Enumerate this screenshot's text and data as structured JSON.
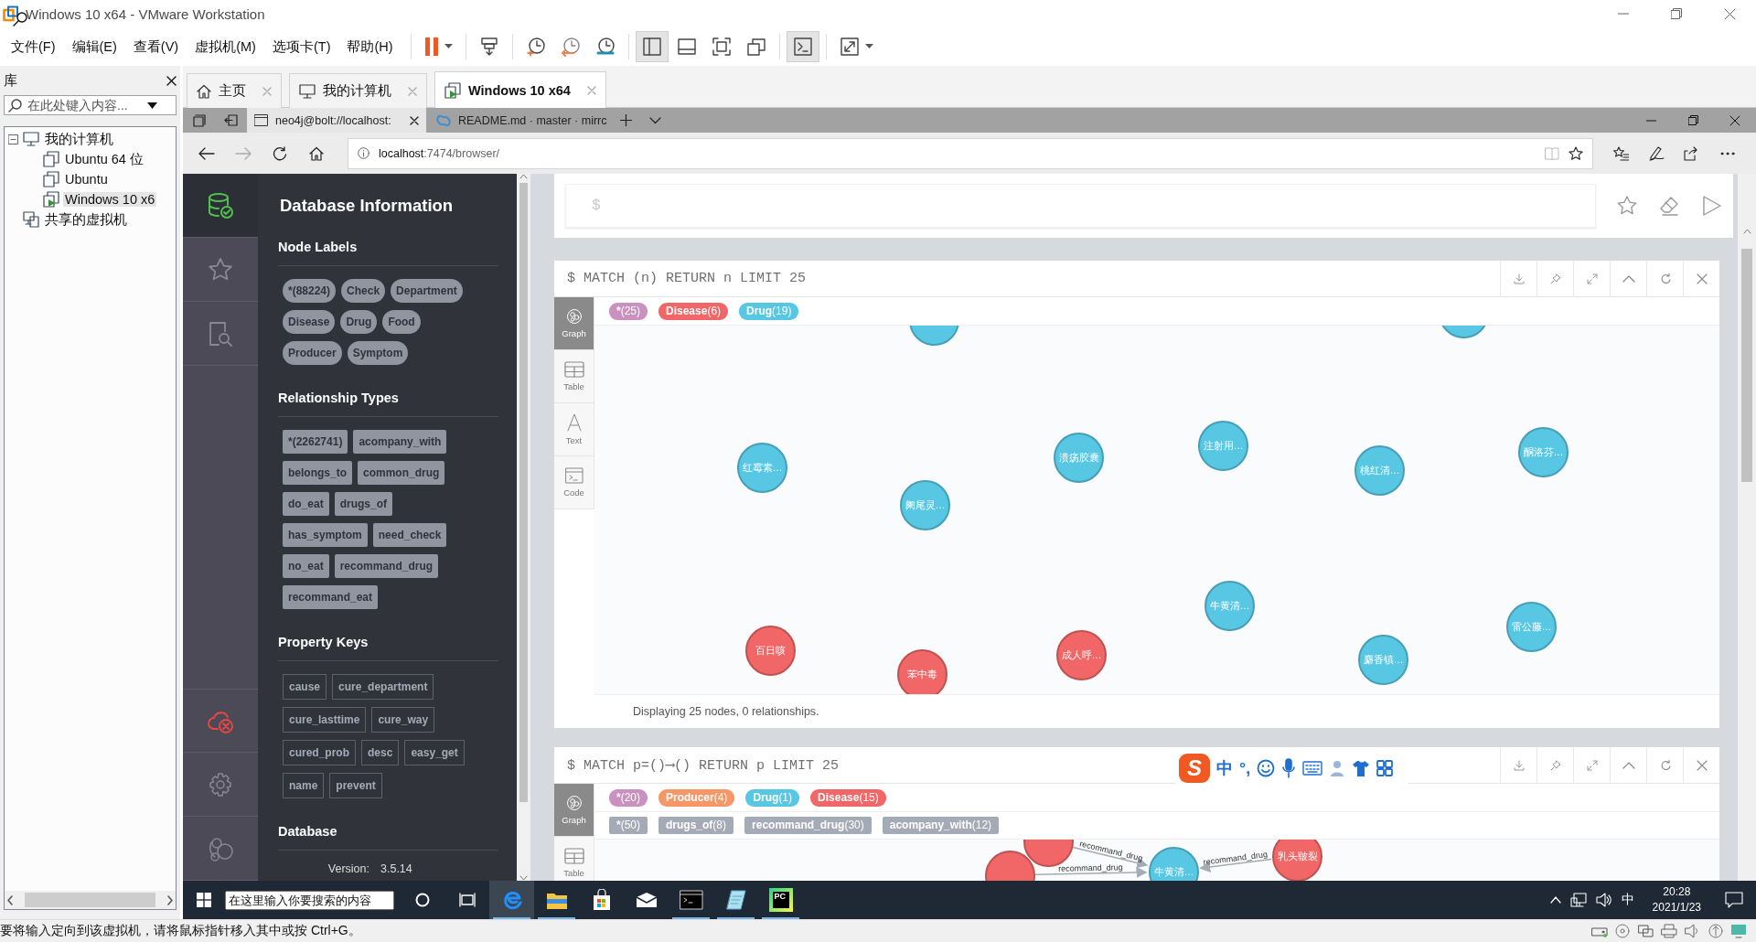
{
  "window": {
    "title": "Windows 10 x64 - VMware Workstation"
  },
  "menu": [
    "文件(F)",
    "编辑(E)",
    "查看(V)",
    "虚拟机(M)",
    "选项卡(T)",
    "帮助(H)"
  ],
  "toolbar": [
    {
      "kind": "pause",
      "on": false
    },
    {
      "kind": "send-keys",
      "on": false
    },
    {
      "kind": "snapshot",
      "on": false
    },
    {
      "kind": "revert",
      "on": false
    },
    {
      "kind": "snapshot-manager",
      "on": false
    },
    {
      "kind": "library",
      "on": true
    },
    {
      "kind": "thumbnails",
      "on": false
    },
    {
      "kind": "fullscreen",
      "on": false
    },
    {
      "kind": "unity",
      "on": false
    },
    {
      "kind": "console",
      "on": true
    },
    {
      "kind": "stretch",
      "on": false
    }
  ],
  "library": {
    "title": "库",
    "search": {
      "placeholder": "在此处键入内容..."
    },
    "tree": [
      {
        "kind": "computer",
        "label": "我的计算机",
        "selected": false,
        "expanded": true,
        "children": [
          {
            "kind": "vm",
            "label": "Ubuntu 64 位",
            "selected": false
          },
          {
            "kind": "vm",
            "label": "Ubuntu",
            "selected": false
          },
          {
            "kind": "running-vm",
            "label": "Windows 10 x6",
            "selected": true
          }
        ]
      },
      {
        "kind": "shared",
        "label": "共享的虚拟机",
        "selected": false
      }
    ]
  },
  "vm_tabs": [
    {
      "kind": "home",
      "label": "主页",
      "selected": false
    },
    {
      "kind": "computer",
      "label": "我的计算机",
      "selected": false
    },
    {
      "kind": "vm",
      "label": "Windows 10 x64",
      "selected": true
    }
  ],
  "browser": {
    "tabs": [
      {
        "kind": "page",
        "label": "neo4j@bolt://localhost:",
        "selected": true
      },
      {
        "kind": "repo",
        "label": "README.md · master · mirrc",
        "selected": false
      }
    ],
    "address": {
      "host": "localhost",
      "path": ":7474/browser/"
    }
  },
  "neo4j": {
    "nav": [
      {
        "kind": "database",
        "selected": true
      },
      {
        "kind": "favorites",
        "selected": false
      },
      {
        "kind": "guides",
        "selected": false
      },
      {
        "kind": "connection",
        "selected": false
      },
      {
        "kind": "settings",
        "selected": false
      },
      {
        "kind": "about",
        "selected": false
      }
    ],
    "sidebar": {
      "title": "Database Information",
      "sections": [
        {
          "kind": "labels",
          "heading": "Node Labels",
          "items": [
            "*(88224)",
            "Check",
            "Department",
            "Disease",
            "Drug",
            "Food",
            "Producer",
            "Symptom"
          ]
        },
        {
          "kind": "relationships",
          "heading": "Relationship Types",
          "items": [
            "*(2262741)",
            "acompany_with",
            "belongs_to",
            "common_drug",
            "do_eat",
            "drugs_of",
            "has_symptom",
            "need_check",
            "no_eat",
            "recommand_drug",
            "recommand_eat"
          ]
        },
        {
          "kind": "properties",
          "heading": "Property Keys",
          "items": [
            "cause",
            "cure_department",
            "cure_lasttime",
            "cure_way",
            "cured_prob",
            "desc",
            "easy_get",
            "name",
            "prevent"
          ]
        },
        {
          "kind": "info",
          "heading": "Database",
          "rows": [
            {
              "key": "Version:",
              "value": "3.5.14"
            }
          ]
        }
      ]
    },
    "editor": {
      "prompt": "$"
    },
    "frames": [
      {
        "query": "$ MATCH (n) RETURN n LIMIT 25",
        "views": [
          {
            "kind": "graph",
            "label": "Graph",
            "selected": true
          },
          {
            "kind": "table",
            "label": "Table",
            "selected": false
          },
          {
            "kind": "text",
            "label": "Text",
            "selected": false
          },
          {
            "kind": "code",
            "label": "Code",
            "selected": false
          }
        ],
        "node_legend": [
          {
            "label": "*",
            "count": "(25)",
            "color": "#c990c0"
          },
          {
            "label": "Disease",
            "count": "(6)",
            "color": "#f16667"
          },
          {
            "label": "Drug",
            "count": "(19)",
            "color": "#57c7e3"
          }
        ],
        "nodes": [
          {
            "color": "#57c7e3"
          },
          {
            "label": "红霉素…",
            "color": "#57c7e3"
          },
          {
            "label": "阑尾灵…",
            "color": "#57c7e3"
          },
          {
            "label": "溃疡胶囊",
            "color": "#57c7e3"
          },
          {
            "label": "注射用…",
            "color": "#57c7e3"
          },
          {
            "label": "桃红清…",
            "color": "#57c7e3"
          },
          {
            "label": "酮洛芬…",
            "color": "#57c7e3"
          },
          {
            "color": "#57c7e3"
          },
          {
            "label": "牛黄清…",
            "color": "#57c7e3"
          },
          {
            "label": "雷公藤…",
            "color": "#57c7e3"
          },
          {
            "label": "麝香镇…",
            "color": "#57c7e3"
          },
          {
            "label": "百日咳",
            "color": "#f16667"
          },
          {
            "label": "苯中毒",
            "color": "#f16667"
          },
          {
            "label": "成人呼…",
            "color": "#f16667"
          }
        ],
        "status": "Displaying 25 nodes, 0 relationships."
      },
      {
        "query": "$ MATCH p=()⟶() RETURN p LIMIT 25",
        "views": [
          {
            "kind": "graph",
            "label": "Graph",
            "selected": true
          },
          {
            "kind": "table",
            "label": "Table",
            "selected": false
          }
        ],
        "node_legend": [
          {
            "label": "*",
            "count": "(20)",
            "color": "#c990c0"
          },
          {
            "label": "Producer",
            "count": "(4)",
            "color": "#f79767"
          },
          {
            "label": "Drug",
            "count": "(1)",
            "color": "#57c7e3"
          },
          {
            "label": "Disease",
            "count": "(15)",
            "color": "#f16667"
          }
        ],
        "relationship_legend": [
          {
            "label": "*",
            "count": "(50)"
          },
          {
            "label": "drugs_of",
            "count": "(8)"
          },
          {
            "label": "recommand_drug",
            "count": "(30)"
          },
          {
            "label": "acompany_with",
            "count": "(12)"
          }
        ],
        "nodes": [
          {
            "color": "#f16667"
          },
          {
            "color": "#f16667"
          },
          {
            "label": "牛黄清…",
            "color": "#57c7e3"
          },
          {
            "label": "乳头皲裂",
            "color": "#f16667"
          }
        ],
        "edges": [
          {
            "label": "recommand_drug"
          },
          {
            "label": "recommand_drug"
          },
          {
            "label": "recommand_drug"
          }
        ]
      }
    ]
  },
  "ime": {
    "logo": "S",
    "mode": "中",
    "punct": "°,"
  },
  "taskbar": {
    "search": {
      "placeholder": "在这里输入你要搜索的内容"
    },
    "apps": [
      {
        "kind": "edge",
        "running": true,
        "selected": true
      },
      {
        "kind": "explorer",
        "running": true,
        "selected": false
      },
      {
        "kind": "store",
        "running": false,
        "selected": false
      },
      {
        "kind": "mail",
        "running": false,
        "selected": false
      },
      {
        "kind": "terminal",
        "running": true,
        "selected": false
      },
      {
        "kind": "notes",
        "running": true,
        "selected": false
      },
      {
        "kind": "pycharm",
        "running": true,
        "selected": false,
        "text": "PC"
      }
    ],
    "tray": {
      "input": "中",
      "time": "20:28",
      "date": "2021/1/23"
    }
  },
  "status_bar": {
    "message": "要将输入定向到该虚拟机，请将鼠标指针移入其中或按 Ctrl+G。"
  }
}
